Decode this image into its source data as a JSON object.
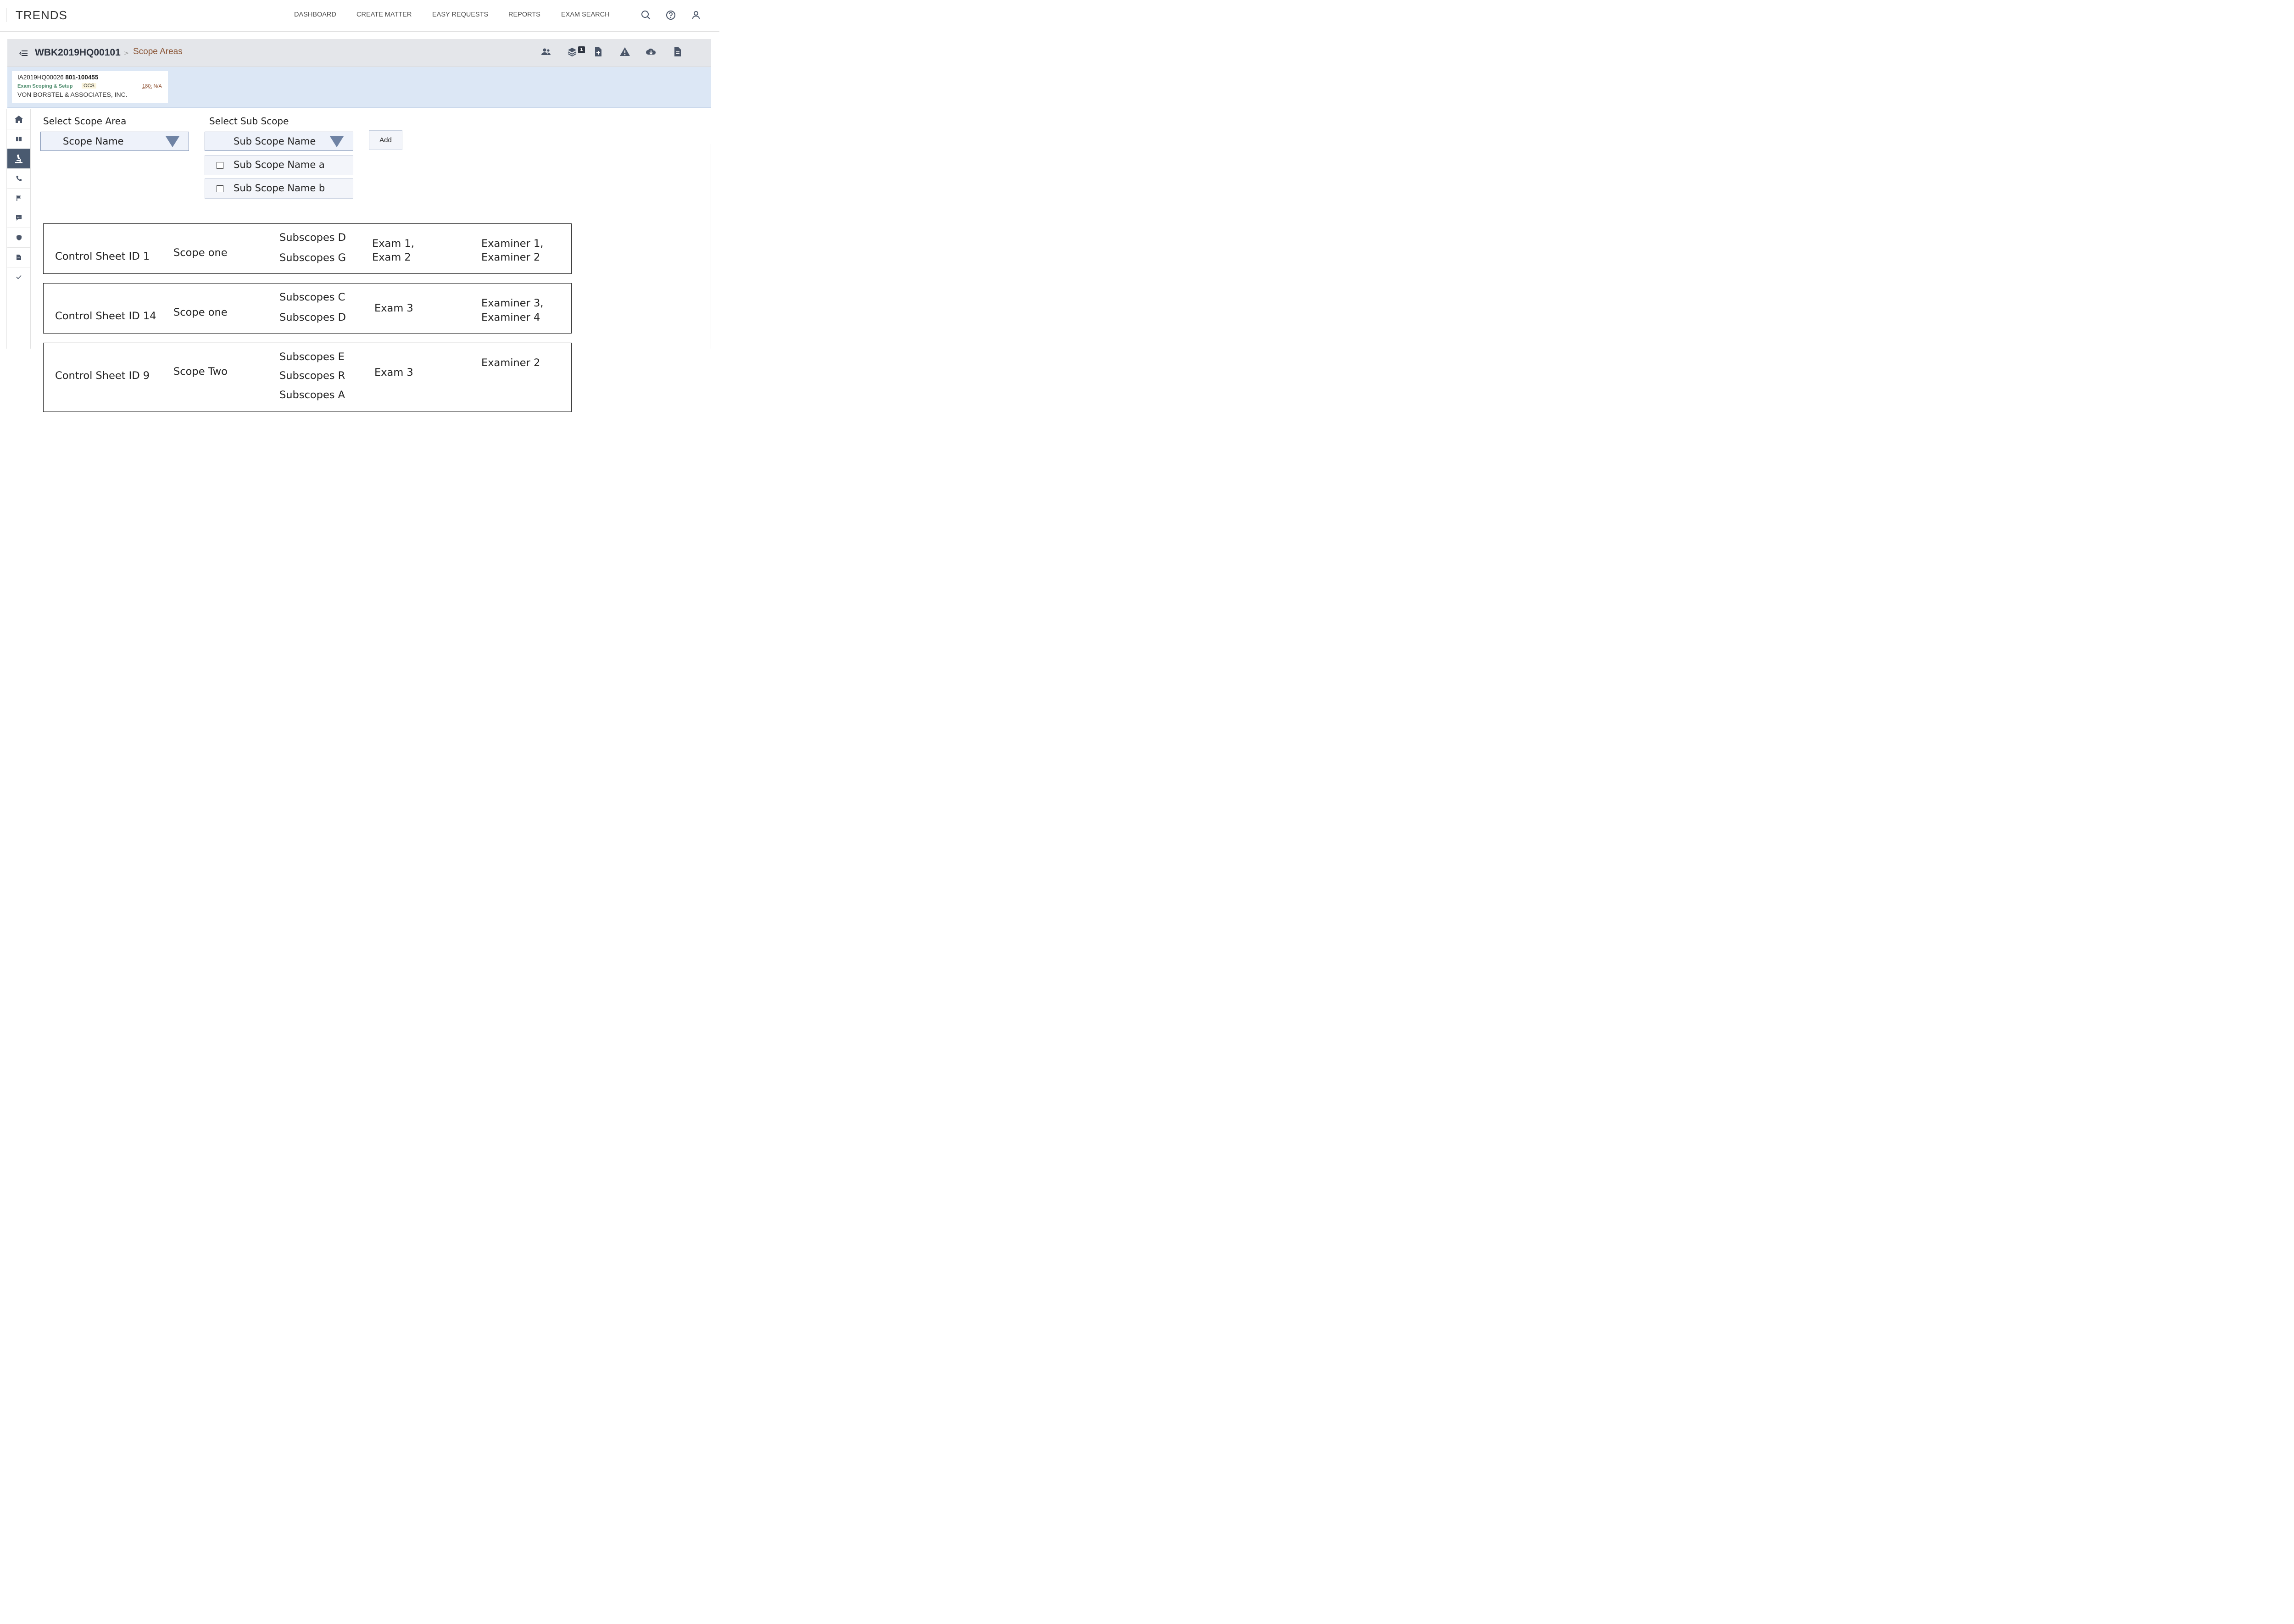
{
  "app": {
    "title": "TRENDS"
  },
  "nav": {
    "items": [
      "DASHBOARD",
      "CREATE MATTER",
      "EASY REQUESTS",
      "REPORTS",
      "EXAM SEARCH"
    ]
  },
  "header_icons": [
    "search-icon",
    "help-icon",
    "user-icon"
  ],
  "matter": {
    "id": "WBK2019HQ00101",
    "separator": ">",
    "page": "Scope Areas",
    "action_icons": [
      "people-icon",
      "layers-icon",
      "add-document-icon",
      "warning-icon",
      "cloud-download-icon",
      "document-icon"
    ],
    "badge_count": "1"
  },
  "info": {
    "ref_id": "IA2019HQ00026",
    "ref_num": "801-100455",
    "status": "Exam Scoping & Setup",
    "tag": "OCS",
    "days_value": "180:",
    "days_suffix": "N/A",
    "company": "VON BORSTEL & ASSOCIATES, INC."
  },
  "rail": {
    "items": [
      "home-icon",
      "book-icon",
      "microscope-icon",
      "phone-icon",
      "flag-icon",
      "chat-icon",
      "shield-icon",
      "file-icon",
      "check-icon"
    ],
    "active": "microscope-icon"
  },
  "form": {
    "scope_label": "Select Scope Area",
    "scope_value": "Scope Name",
    "sub_scope_label": "Select Sub Scope",
    "sub_scope_value": "Sub Scope Name",
    "sub_scope_options": [
      "Sub Scope Name a",
      "Sub Scope Name b"
    ],
    "add_label": "Add"
  },
  "rows": [
    {
      "control_sheet": "Control Sheet  ID 1",
      "scope": "Scope  one",
      "subscopes": [
        "Subscopes D",
        "Subscopes G"
      ],
      "exams": [
        "Exam  1,",
        "Exam 2"
      ],
      "examiners": [
        "Examiner 1,",
        "Examiner 2"
      ]
    },
    {
      "control_sheet": "Control Sheet  ID 14",
      "scope": "Scope  one",
      "subscopes": [
        "Subscopes C",
        "Subscopes D"
      ],
      "exams": [
        "Exam 3"
      ],
      "examiners": [
        "Examiner 3,",
        "Examiner 4"
      ]
    },
    {
      "control_sheet": "Control Sheet ID 9",
      "scope": "Scope  Two",
      "subscopes": [
        "Subscopes E",
        "Subscopes R",
        "Subscopes A"
      ],
      "exams": [
        "Exam 3"
      ],
      "examiners": [
        "Examiner 2"
      ]
    }
  ],
  "colors": {
    "matter_bar": "#e4e6ea",
    "info_band": "#dce7f5",
    "active_rail": "#4a5a70",
    "icon": "#4a5568",
    "breadcrumb_page": "#8a5535",
    "status_green": "#4a8a6a"
  }
}
